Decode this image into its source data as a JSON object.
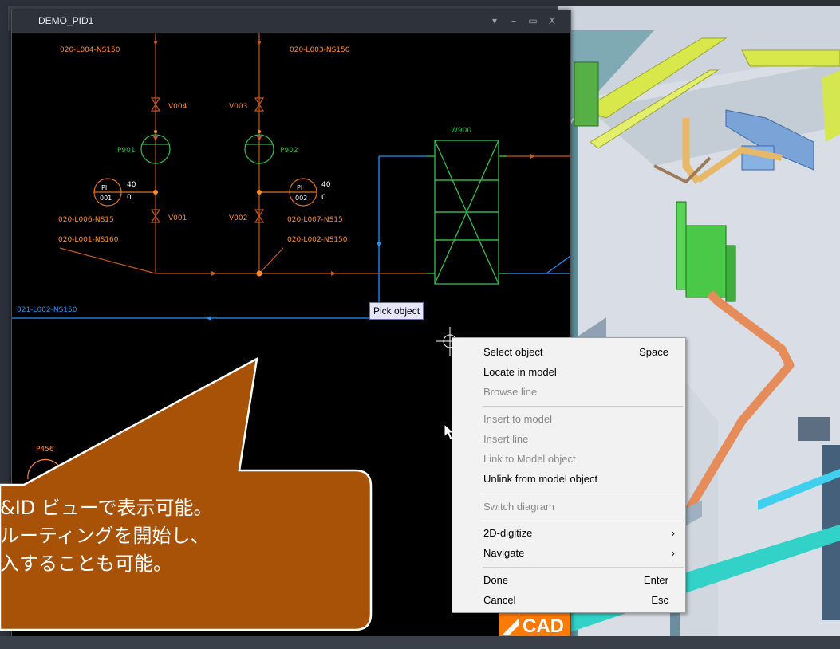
{
  "window": {
    "title": "DEMO_PID1",
    "controls": {
      "dropdown": "▾",
      "minimize": "–",
      "maximize": "▭",
      "close": "X"
    }
  },
  "pid": {
    "line_labels": {
      "top_left": "020-L004-NS150",
      "top_right": "020-L003-NS150",
      "mid_left": "020-L006-NS15",
      "mid_right": "020-L007-NS15",
      "lower_left": "020-L001-NS160",
      "lower_right": "020-L002-NS150",
      "bottom": "021-L002-NS150"
    },
    "valves": [
      "V004",
      "V003",
      "V001",
      "V002"
    ],
    "pumps": [
      "P901",
      "P902",
      "P456"
    ],
    "instruments": [
      {
        "tag": "PI",
        "num": "001",
        "hi": "40",
        "lo": "0"
      },
      {
        "tag": "PI",
        "num": "002",
        "hi": "40",
        "lo": "0"
      }
    ],
    "equipment": "W900",
    "colors": {
      "pipe": "#e07020",
      "equipment": "#2fb54a",
      "blue_line": "#2a8ff0",
      "label": "#ff8c2a"
    }
  },
  "tooltip": "Pick object",
  "context_menu": {
    "items": [
      {
        "label": "Select object",
        "shortcut": "Space",
        "enabled": true
      },
      {
        "label": "Locate in model",
        "shortcut": "",
        "enabled": true
      },
      {
        "label": "Browse line",
        "shortcut": "",
        "enabled": false
      },
      {
        "label": "Insert to model",
        "shortcut": "",
        "enabled": false
      },
      {
        "label": "Insert line",
        "shortcut": "",
        "enabled": false
      },
      {
        "label": "Link to Model object",
        "shortcut": "",
        "enabled": false
      },
      {
        "label": "Unlink from model object",
        "shortcut": "",
        "enabled": true
      },
      {
        "label": "Switch diagram",
        "shortcut": "",
        "enabled": false
      },
      {
        "label": "2D-digitize",
        "submenu": true,
        "enabled": true
      },
      {
        "label": "Navigate",
        "submenu": true,
        "enabled": true
      },
      {
        "label": "Done",
        "shortcut": "Enter",
        "enabled": true
      },
      {
        "label": "Cancel",
        "shortcut": "Esc",
        "enabled": true
      }
    ],
    "submenu_arrow": "›"
  },
  "callout": {
    "lines": [
      "&ID ビューで表示可能。",
      "ルーティングを開始し、",
      "入することも可能。"
    ],
    "color": "#a85208"
  },
  "logo": {
    "text": "CAD"
  },
  "icons": [
    "crosshair-cursor-icon",
    "arrow-cursor-icon",
    "cadmatic-logo-icon"
  ]
}
